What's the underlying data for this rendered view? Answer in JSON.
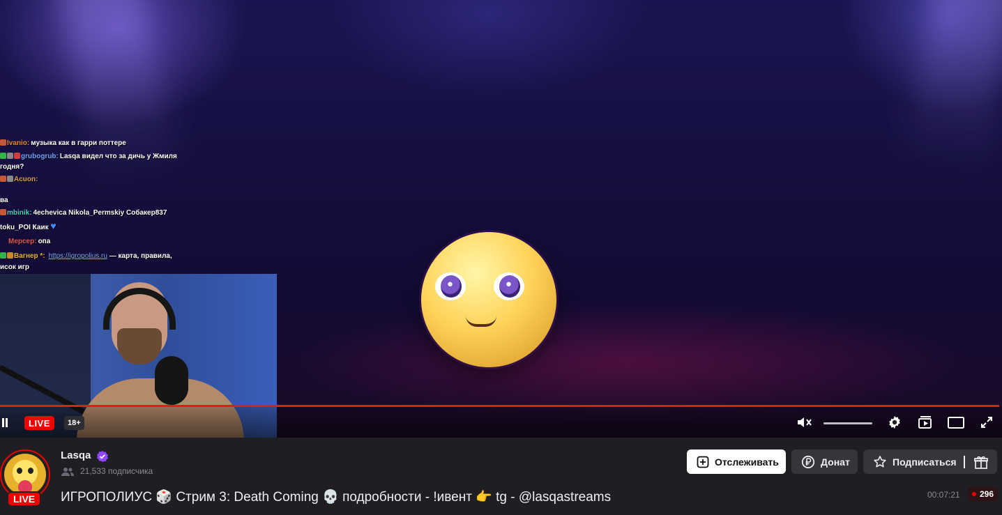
{
  "stream": {
    "chat_overlay": [
      {
        "user": "Ivanio:",
        "user_color": "#e48a2a",
        "message": "музыка как в гарри поттере"
      },
      {
        "user": "grubogrub:",
        "user_color": "#6ea2ff",
        "message": "Lasqa видел что за дичь у Жмиля"
      },
      {
        "user": "",
        "user_color": "#ffffff",
        "message": "годня?"
      },
      {
        "user": "Acuon:",
        "user_color": "#d9a14a",
        "message": ""
      },
      {
        "user": "",
        "user_color": "#ffffff",
        "message": "ва"
      },
      {
        "user": "mbinik:",
        "user_color": "#4fd1c5",
        "message": "4echevica Nikola_Permskiy Собакер837"
      },
      {
        "user": "",
        "user_color": "#ffffff",
        "message": "toku_POI Каик"
      },
      {
        "user": "Мерсер:",
        "user_color": "#e05a5a",
        "message": "опа"
      },
      {
        "user": "Вагнер *:",
        "user_color": "#e8b33a",
        "message": "— карта, правила,",
        "link": "https://igropolius.ru"
      },
      {
        "user": "",
        "user_color": "#ffffff",
        "message": "исок игр"
      }
    ],
    "progress_color": "#e91916"
  },
  "player_controls": {
    "live_label": "LIVE",
    "age_label": "18+",
    "volume_level": 0
  },
  "channel": {
    "name": "Lasqa",
    "followers": "21,533 подписчика",
    "avatar_live_label": "LIVE",
    "title": "ИГРОПОЛИУС 🎲 Стрим 3: Death Coming 💀 подробности - !ивент 👉 tg - @lasqastreams",
    "uptime": "00:07:21",
    "viewers": "296"
  },
  "actions": {
    "follow_label": "Отслеживать",
    "donate_label": "Донат",
    "subscribe_label": "Подписаться"
  },
  "colors": {
    "live_red": "#eb0400",
    "verified_purple": "#9147ff",
    "bar_bg": "#1f1f23",
    "button_dark": "#35353b"
  },
  "icons": [
    "pause-icon",
    "mute-icon",
    "gear-icon",
    "clip-icon",
    "theatre-icon",
    "fullscreen-icon",
    "verified-icon",
    "followers-icon",
    "plus-icon",
    "ruble-icon",
    "star-icon",
    "gift-icon"
  ]
}
